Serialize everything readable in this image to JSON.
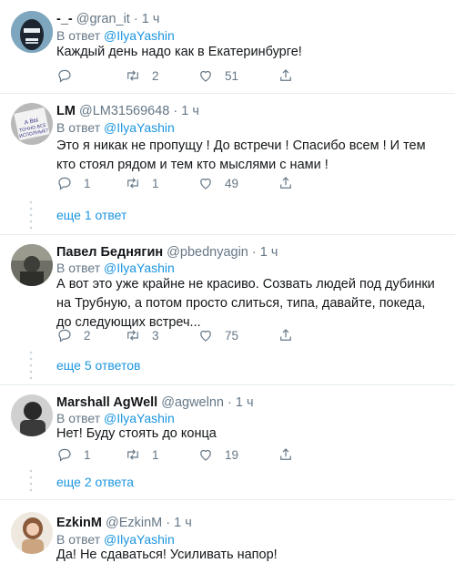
{
  "reply_prefix": "В ответ",
  "mention": "@IlyaYashin",
  "dot": "·",
  "tweets": [
    {
      "name": "-_-",
      "handle": "@gran_it",
      "time": "1 ч",
      "text": "Каждый день надо как в Екатеринбурге!",
      "replies": "",
      "retweets": "2",
      "likes": "51"
    },
    {
      "name": "LM",
      "handle": "@LM31569648",
      "time": "1 ч",
      "text": "Это я никак не пропущу ! До встречи ! Спасибо всем ! И тем кто стоял рядом и тем кто мыслями с нами !",
      "replies": "1",
      "retweets": "1",
      "likes": "49",
      "more": "еще 1 ответ",
      "avatar_text": "А ВЫ ТОЧНО ВСЕ ИСПОЛНЫЕ?"
    },
    {
      "name": "Павел Беднягин",
      "handle": "@pbednyagin",
      "time": "1 ч",
      "text": "А вот это уже крайне не красиво. Созвать людей под дубинки на Трубную, а потом просто слиться, типа, давайте, покеда, до следующих встреч...",
      "replies": "2",
      "retweets": "3",
      "likes": "75",
      "more": "еще 5 ответов"
    },
    {
      "name": "Marshall AgWell",
      "handle": "@agwelnn",
      "time": "1 ч",
      "text": "Нет! Буду стоять до конца",
      "replies": "1",
      "retweets": "1",
      "likes": "19",
      "more": "еще 2 ответа"
    },
    {
      "name": "EzkinM",
      "handle": "@EzkinM",
      "time": "1 ч",
      "text": "Да! Не сдаваться! Усиливать напор!"
    }
  ],
  "colors": {
    "link": "#1b95e0",
    "muted": "#657786",
    "text": "#14171a",
    "divider": "#e6ecf0"
  },
  "icons": [
    "reply-icon",
    "retweet-icon",
    "like-icon",
    "share-icon",
    "more-dots-icon"
  ]
}
